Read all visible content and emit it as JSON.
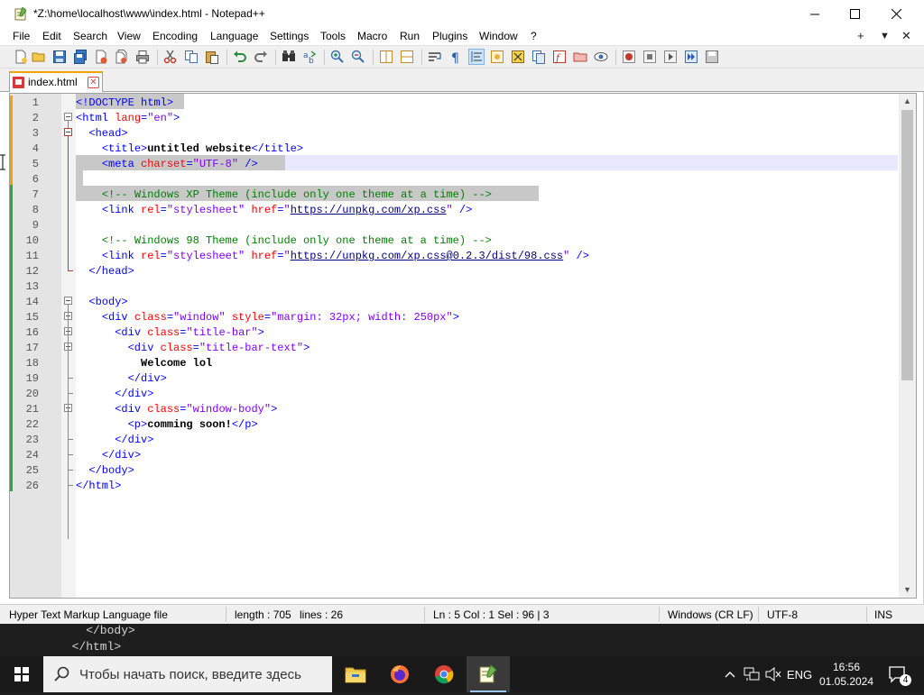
{
  "window": {
    "title": "*Z:\\home\\localhost\\www\\index.html - Notepad++"
  },
  "menu": {
    "items": [
      "File",
      "Edit",
      "Search",
      "View",
      "Encoding",
      "Language",
      "Settings",
      "Tools",
      "Macro",
      "Run",
      "Plugins",
      "Window",
      "?"
    ],
    "right": [
      "+",
      "▼",
      "✕"
    ]
  },
  "tab": {
    "label": "index.html"
  },
  "editor": {
    "current_line": 5,
    "lines": [
      {
        "n": "1",
        "code": "<!DOCTYPE html>"
      },
      {
        "n": "2",
        "code": "<html lang=\"en\">"
      },
      {
        "n": "3",
        "code": "  <head>"
      },
      {
        "n": "4",
        "code": "    <title>untitled website</title>"
      },
      {
        "n": "5",
        "code": "    <meta charset=\"UTF-8\" />"
      },
      {
        "n": "6",
        "code": ""
      },
      {
        "n": "7",
        "code": "    <!-- Windows XP Theme (include only one theme at a time) -->"
      },
      {
        "n": "8",
        "code": "    <link rel=\"stylesheet\" href=\"https://unpkg.com/xp.css\" />"
      },
      {
        "n": "9",
        "code": ""
      },
      {
        "n": "10",
        "code": "    <!-- Windows 98 Theme (include only one theme at a time) -->"
      },
      {
        "n": "11",
        "code": "    <link rel=\"stylesheet\" href=\"https://unpkg.com/xp.css@0.2.3/dist/98.css\" />"
      },
      {
        "n": "12",
        "code": "  </head>"
      },
      {
        "n": "13",
        "code": ""
      },
      {
        "n": "14",
        "code": "  <body>"
      },
      {
        "n": "15",
        "code": "    <div class=\"window\" style=\"margin: 32px; width: 250px\">"
      },
      {
        "n": "16",
        "code": "      <div class=\"title-bar\">"
      },
      {
        "n": "17",
        "code": "        <div class=\"title-bar-text\">"
      },
      {
        "n": "18",
        "code": "          Welcome lol"
      },
      {
        "n": "19",
        "code": "        </div>"
      },
      {
        "n": "20",
        "code": "      </div>"
      },
      {
        "n": "21",
        "code": "      <div class=\"window-body\">"
      },
      {
        "n": "22",
        "code": "        <p>comming soon!</p>"
      },
      {
        "n": "23",
        "code": "      </div>"
      },
      {
        "n": "24",
        "code": "    </div>"
      },
      {
        "n": "25",
        "code": "  </body>"
      },
      {
        "n": "26",
        "code": "</html>"
      }
    ]
  },
  "status": {
    "file_type": "Hyper Text Markup Language file",
    "length": "length : 705",
    "lines": "lines : 26",
    "position": "Ln : 5    Col : 1    Sel : 96 | 3",
    "eol": "Windows (CR LF)",
    "encoding": "UTF-8",
    "mode": "INS"
  },
  "background_terminal": {
    "line1": "    </body>",
    "line2": "  </html>"
  },
  "taskbar": {
    "search_placeholder": "Чтобы начать поиск, введите здесь",
    "language": "ENG",
    "time": "16:56",
    "date": "01.05.2024",
    "notifications": "4"
  }
}
